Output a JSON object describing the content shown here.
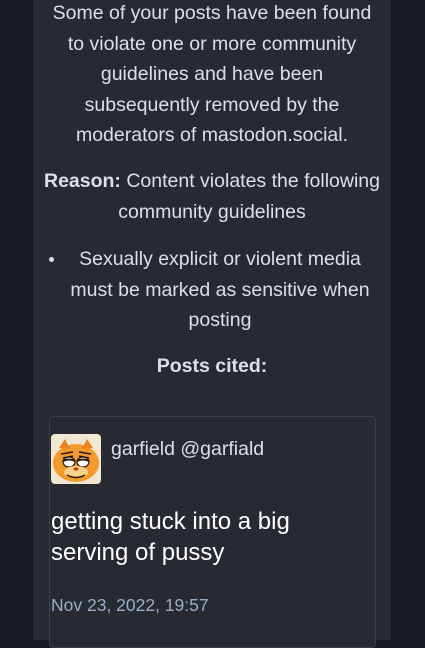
{
  "notice": {
    "text": "Some of your posts have been found to violate one or more community guidelines and have been subsequently removed by the moderators of mastodon.social."
  },
  "reason": {
    "label": "Reason:",
    "text": " Content violates the following community guidelines"
  },
  "rules": [
    "Sexually explicit or violent media must be marked as sensitive when posting"
  ],
  "cited": {
    "heading": "Posts cited:"
  },
  "post": {
    "author": "garfield @garfiald",
    "avatar_icon": "garfield-avatar-icon",
    "content": "getting stuck into a big serving of pussy",
    "date": "Nov 23, 2022, 19:57"
  },
  "colors": {
    "page_background": "#191b22",
    "panel_background": "#282c37",
    "text_primary": "#d9e1e8",
    "text_muted": "#9baec8",
    "border": "#393f4f"
  }
}
